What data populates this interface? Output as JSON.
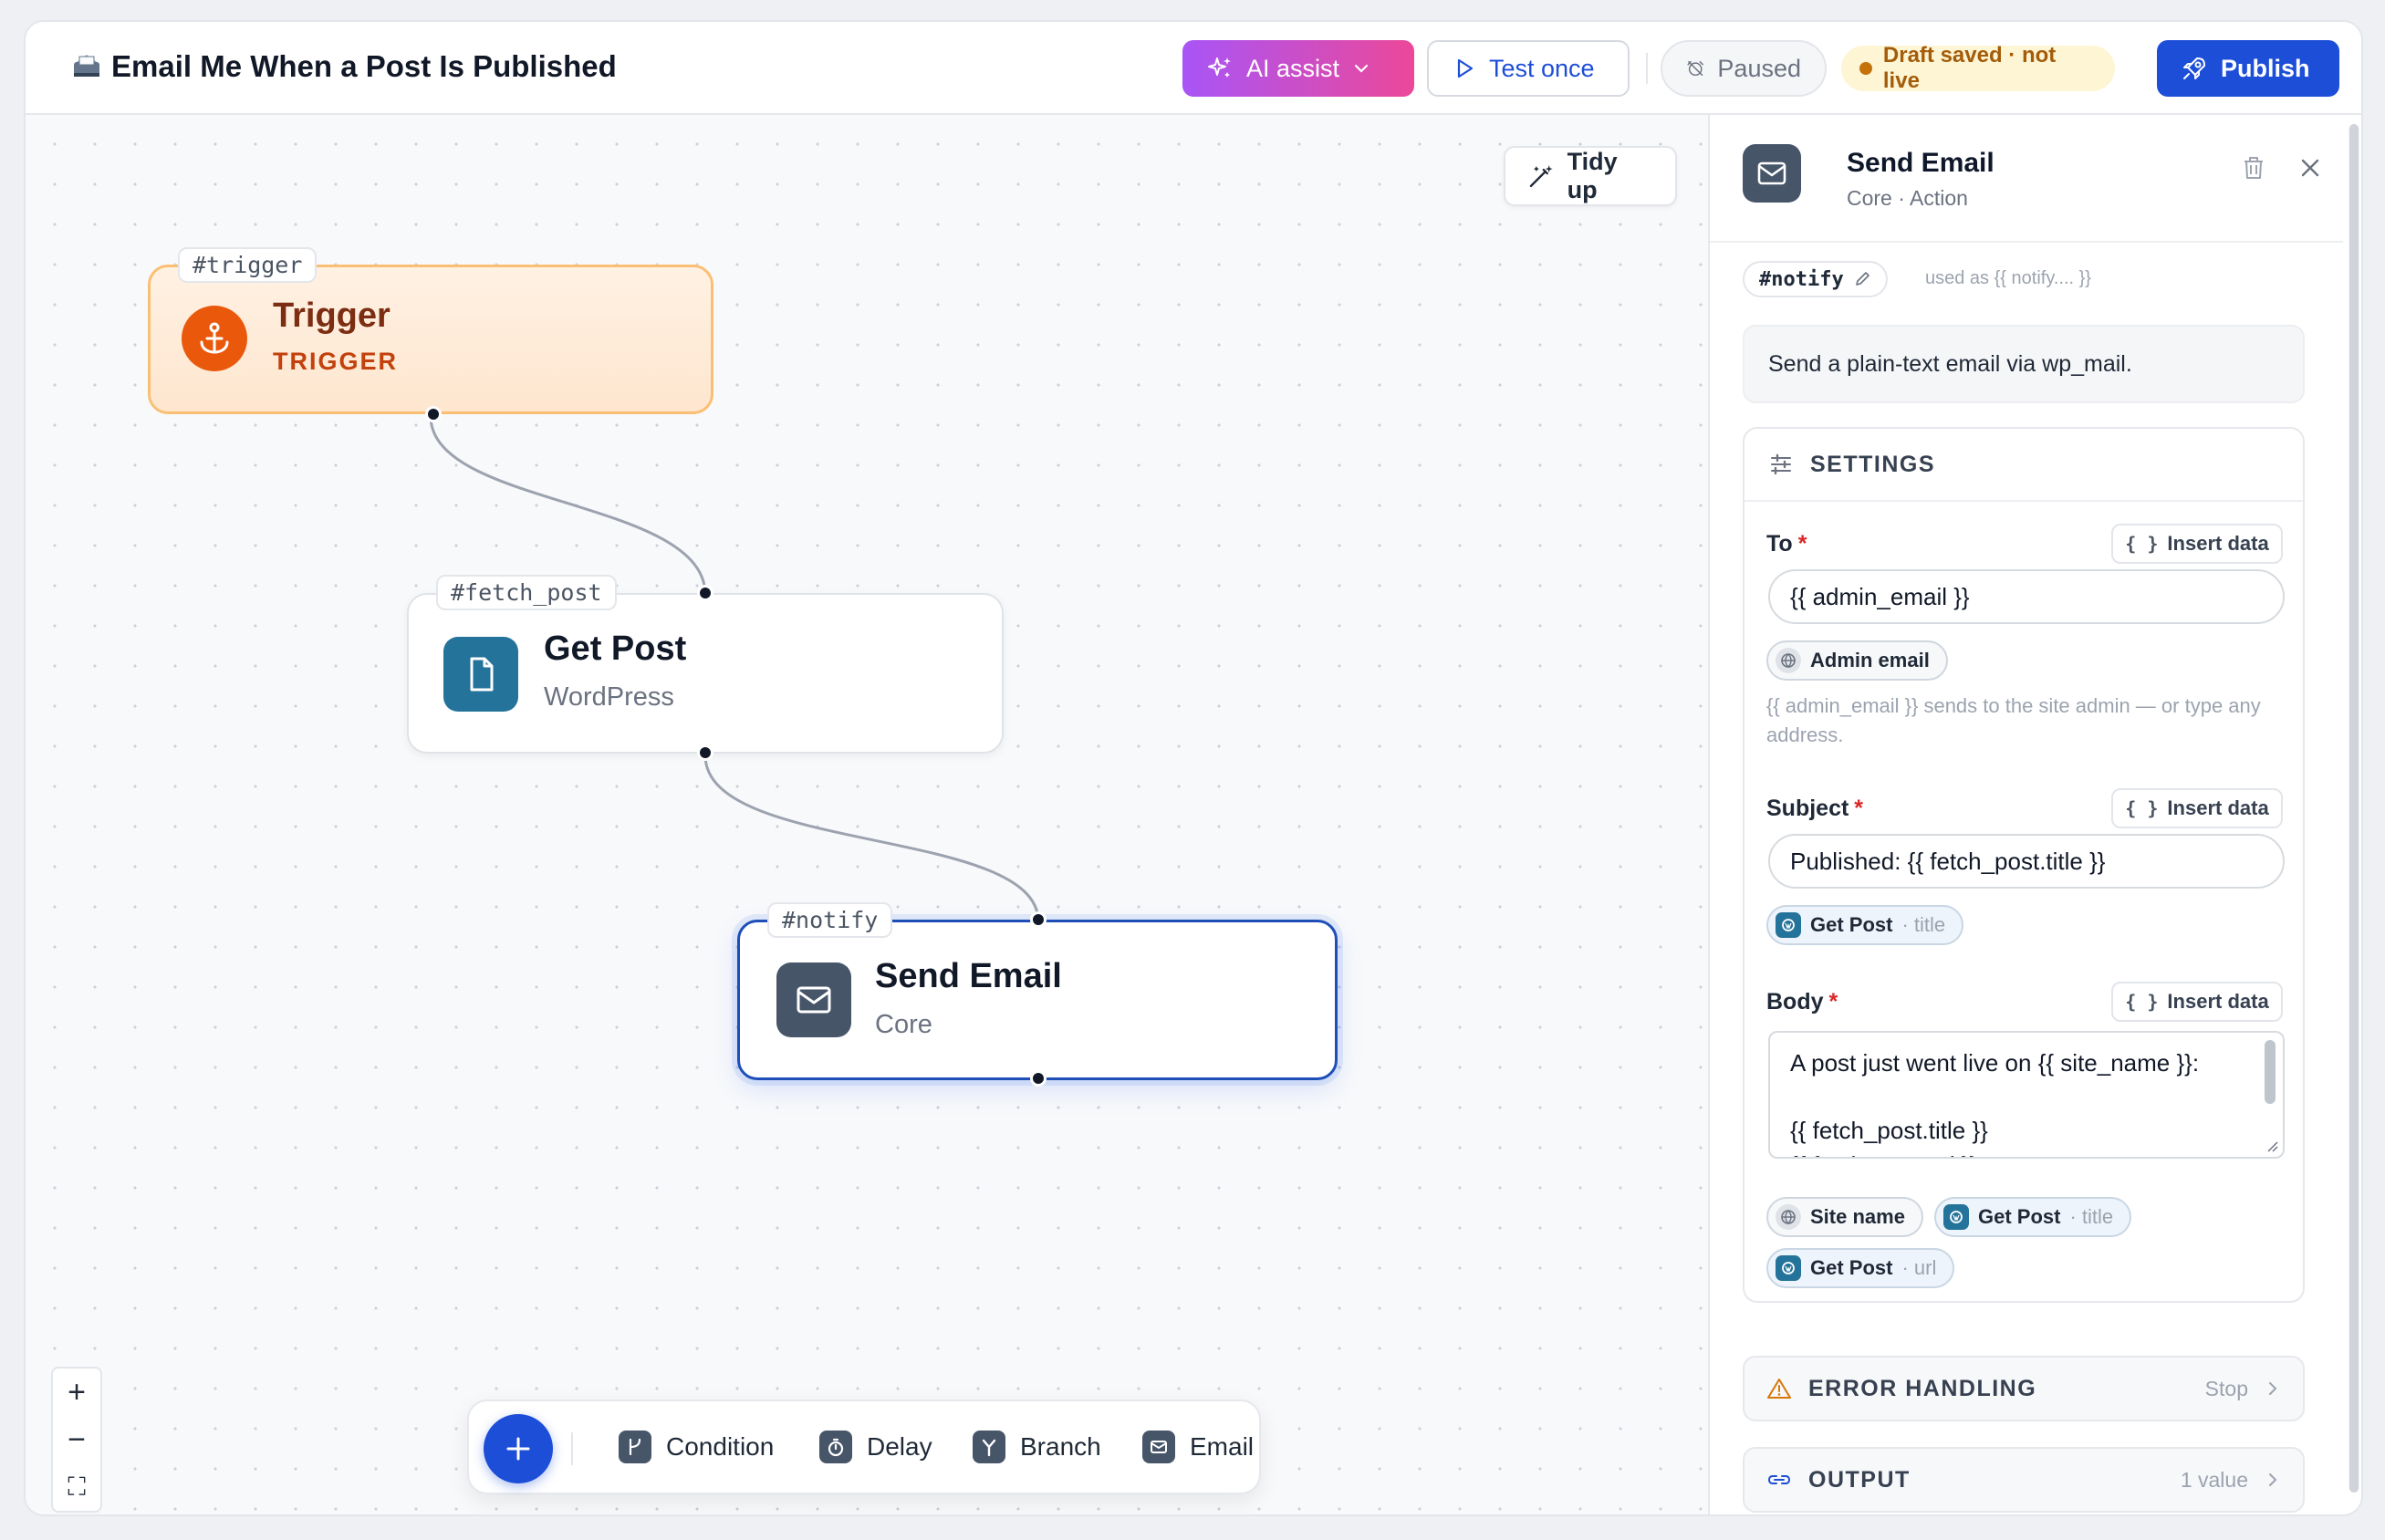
{
  "header": {
    "title": "Email Me When a Post Is Published",
    "ai_assist": "AI assist",
    "test_once": "Test once",
    "paused": "Paused",
    "draft_status": "Draft saved · not live",
    "publish": "Publish"
  },
  "canvas": {
    "tidy_up": "Tidy up",
    "nodes": {
      "trigger": {
        "tag": "#trigger",
        "title": "Trigger",
        "subtitle": "TRIGGER"
      },
      "fetch": {
        "tag": "#fetch_post",
        "title": "Get Post",
        "subtitle": "WordPress"
      },
      "notify": {
        "tag": "#notify",
        "title": "Send Email",
        "subtitle": "Core"
      }
    },
    "zoom": {
      "in": "+",
      "out": "−",
      "fit": "⛶"
    },
    "palette": {
      "condition": "Condition",
      "delay": "Delay",
      "branch": "Branch",
      "email": "Email"
    }
  },
  "panel": {
    "title": "Send Email",
    "subtitle": "Core · Action",
    "node_id": "#notify",
    "used_as": "used as {{ notify.... }}",
    "description": "Send a plain-text email via wp_mail.",
    "settings": {
      "heading": "SETTINGS",
      "insert_data": "Insert data",
      "to": {
        "label": "To",
        "value": "{{ admin_email }}",
        "pill": "Admin email",
        "hint": "{{ admin_email }} sends to the site admin — or type any address."
      },
      "subject": {
        "label": "Subject",
        "value": "Published: {{ fetch_post.title }}",
        "pill": {
          "name": "Get Post",
          "suffix": "· title"
        }
      },
      "body": {
        "label": "Body",
        "line1": "A post just went live on {{ site_name }}:",
        "line2": "",
        "line3": "{{ fetch_post.title }}",
        "line4": "{{ fetch_post.url }}",
        "pills": {
          "site_name": "Site name",
          "get_post_title": {
            "name": "Get Post",
            "suffix": "· title"
          },
          "get_post_url": {
            "name": "Get Post",
            "suffix": "· url"
          }
        }
      }
    },
    "error_handling": {
      "label": "ERROR HANDLING",
      "value": "Stop"
    },
    "output": {
      "label": "OUTPUT",
      "value": "1 value"
    }
  }
}
